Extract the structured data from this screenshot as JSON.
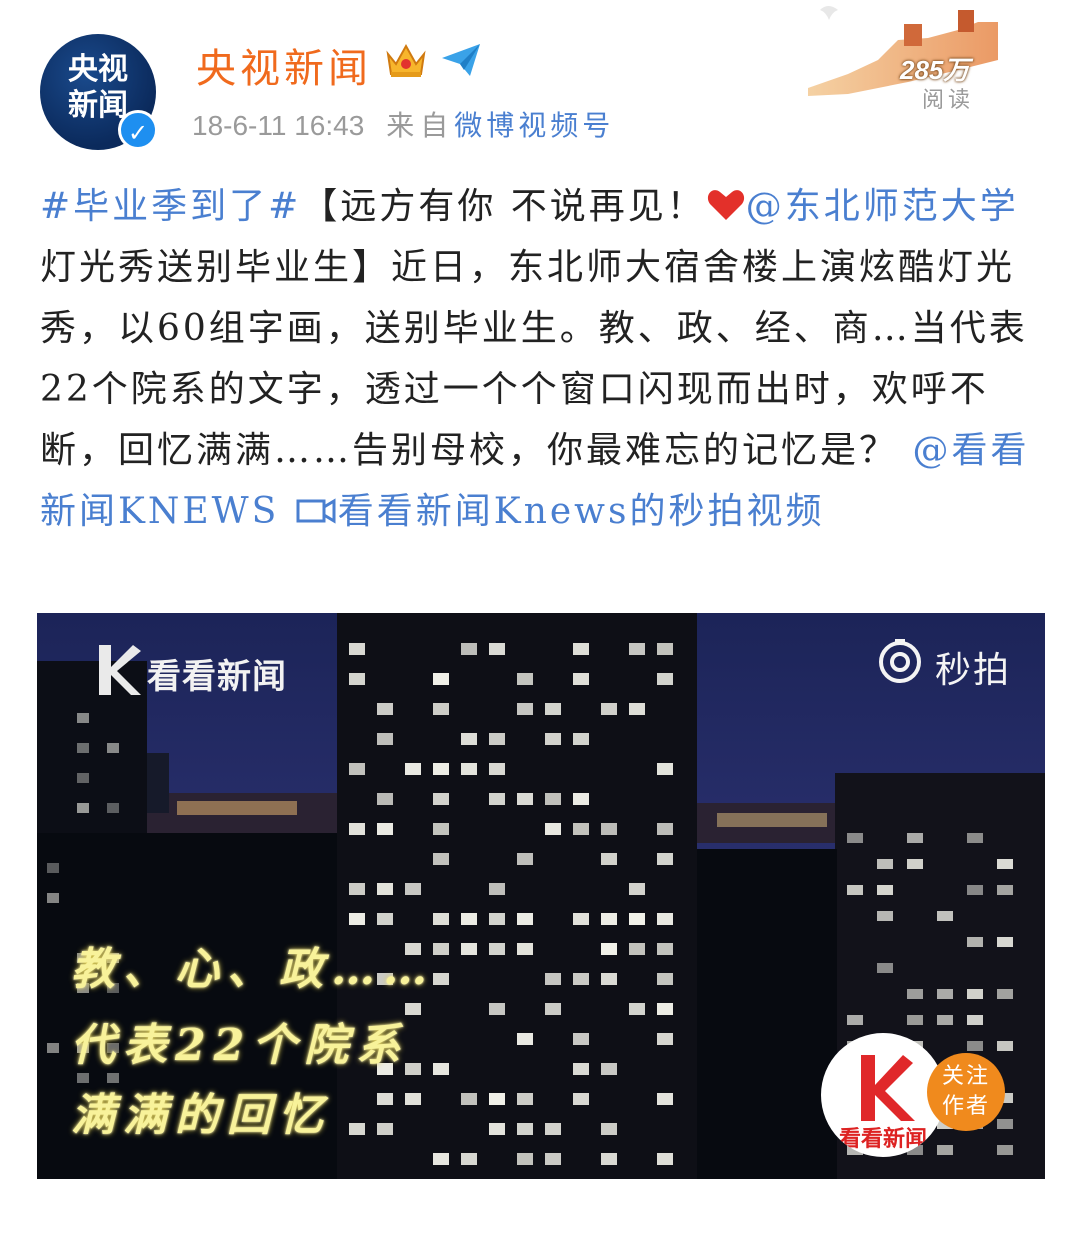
{
  "header": {
    "avatar_line1": "央视",
    "avatar_line2": "新闻",
    "username": "央视新闻",
    "timestamp": "18-6-11 16:43",
    "from_label": "来自",
    "source": "微博视频号",
    "reads_count": "285万",
    "reads_label": "阅读"
  },
  "post": {
    "hashtag": "#毕业季到了#",
    "bracket_open": "【远方有你 不说再见！",
    "mention_school": "@东北师范大学",
    "title_rest": " 灯光秀送别毕业生】",
    "body": "近日，东北师大宿舍楼上演炫酷灯光秀，以60组字画，送别毕业生。教、政、经、商…当代表22个院系的文字，透过一个个窗口闪现而出时，欢呼不断，回忆满满……告别母校，你最难忘的记忆是？",
    "mention_news": "@看看新闻KNEWS",
    "video_link": "看看新闻Knews的秒拍视频"
  },
  "video": {
    "watermark": "看看新闻",
    "platform": "秒拍",
    "caption1": "教、心、政……",
    "caption2": "代表22个院系",
    "caption3": "满满的回忆",
    "author_name": "看看新闻",
    "follow_line1": "关注",
    "follow_line2": "作者"
  },
  "colors": {
    "username": "#f06a1d",
    "link": "#4a7fd0",
    "meta": "#9a9a9a",
    "follow": "#f08a1d",
    "verified": "#1e8ff0"
  },
  "icons": [
    "verified-icon",
    "crown-icon",
    "paper-plane-icon",
    "heart-icon",
    "video-link-icon",
    "knews-logo-icon",
    "miaopai-icon"
  ]
}
